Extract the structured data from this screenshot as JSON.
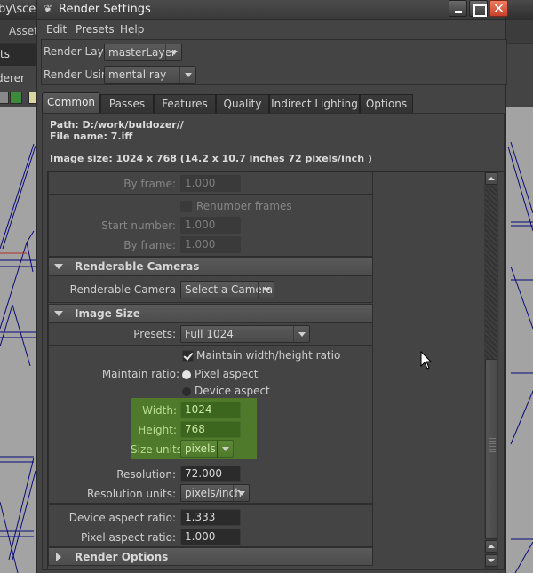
{
  "background_app": {
    "title_fragment": "by\\scen",
    "menu_fragment": "Assets",
    "panel_fragment": "ts",
    "renderer_fragment": "derer"
  },
  "window": {
    "title": "Render Settings",
    "buttons": {
      "minimize": "minimize",
      "maximize": "maximize",
      "close": "close"
    }
  },
  "menubar": [
    "Edit",
    "Presets",
    "Help"
  ],
  "render_layer": {
    "label": "Render Layer",
    "value": "masterLayer"
  },
  "render_using": {
    "label": "Render Using",
    "value": "mental ray"
  },
  "tabs": [
    {
      "label": "Common",
      "active": true
    },
    {
      "label": "Passes",
      "active": false
    },
    {
      "label": "Features",
      "active": false
    },
    {
      "label": "Quality",
      "active": false
    },
    {
      "label": "Indirect Lighting",
      "active": false
    },
    {
      "label": "Options",
      "active": false
    }
  ],
  "info": {
    "path": "Path: D:/work/buldozer//",
    "file_name": "File name:  7.iff",
    "image_size": "Image size: 1024 x 768 (14.2 x 10.7 inches 72 pixels/inch )"
  },
  "frame_range": {
    "by_frame_1": {
      "label": "By frame:",
      "value": "1.000"
    },
    "renumber_frames": {
      "label": "Renumber frames",
      "checked": false
    },
    "start_number": {
      "label": "Start number:",
      "value": "1.000"
    },
    "by_frame_2": {
      "label": "By frame:",
      "value": "1.000"
    }
  },
  "renderable_cameras": {
    "title": "Renderable Cameras",
    "camera": {
      "label": "Renderable Camera",
      "value": "Select a Camera"
    }
  },
  "image_size": {
    "title": "Image Size",
    "presets": {
      "label": "Presets:",
      "value": "Full 1024"
    },
    "maintain_ratio_check": {
      "label": "Maintain width/height ratio",
      "checked": true
    },
    "maintain_ratio": {
      "label": "Maintain ratio:",
      "options": [
        {
          "label": "Pixel aspect",
          "selected": true
        },
        {
          "label": "Device aspect",
          "selected": false
        }
      ]
    },
    "width": {
      "label": "Width:",
      "value": "1024"
    },
    "height": {
      "label": "Height:",
      "value": "768"
    },
    "size_units": {
      "label": "Size units:",
      "value": "pixels"
    },
    "resolution": {
      "label": "Resolution:",
      "value": "72.000"
    },
    "resolution_units": {
      "label": "Resolution units:",
      "value": "pixels/inch"
    },
    "device_aspect_ratio": {
      "label": "Device aspect ratio:",
      "value": "1.333"
    },
    "pixel_aspect_ratio": {
      "label": "Pixel aspect ratio:",
      "value": "1.000"
    }
  },
  "render_options": {
    "title": "Render Options"
  },
  "colors": {
    "highlight_green": "#4f7a2b",
    "close_button": "#e05a3c",
    "panel_bg": "#444444",
    "wireframe": "#000080"
  }
}
